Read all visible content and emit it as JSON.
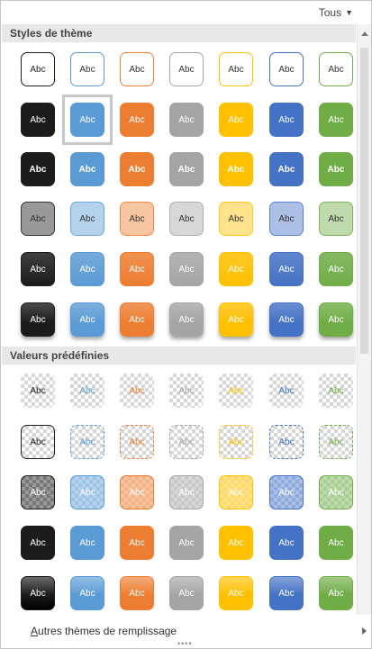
{
  "filter": {
    "label": "Tous",
    "icon": "chevron-down-icon"
  },
  "sections": [
    {
      "title": "Styles de thème"
    },
    {
      "title": "Valeurs prédéfinies"
    }
  ],
  "swatch_label": "Abc",
  "colors": {
    "black": "#1c1c1c",
    "blue": "#5b9bd5",
    "orange": "#ed7d31",
    "gray": "#a5a5a5",
    "gold": "#ffc000",
    "dark_blue": "#4472c4",
    "green": "#70ad47",
    "selection_border": "#c8c8c8"
  },
  "theme_styles": {
    "rows": [
      {
        "kind": "outline",
        "selected_index": null
      },
      {
        "kind": "solid",
        "selected_index": 1
      },
      {
        "kind": "solid-bold",
        "selected_index": null
      },
      {
        "kind": "light",
        "selected_index": null
      },
      {
        "kind": "shaded",
        "selected_index": null
      },
      {
        "kind": "shaded-shadow",
        "selected_index": null
      }
    ]
  },
  "presets": {
    "rows": [
      {
        "kind": "transparent-text"
      },
      {
        "kind": "transparent-outline"
      },
      {
        "kind": "semi-transparent"
      },
      {
        "kind": "solid"
      },
      {
        "kind": "gradient"
      }
    ]
  },
  "footer": {
    "label": "Autres thèmes de remplissage",
    "accelerator": "A",
    "icon": "chevron-right-icon"
  }
}
